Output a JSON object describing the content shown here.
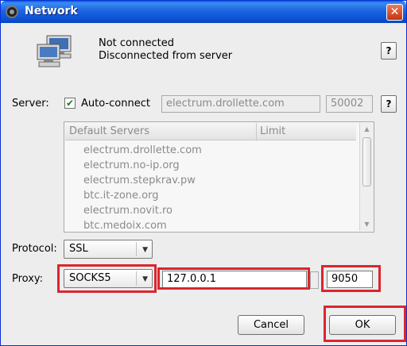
{
  "window": {
    "title": "Network",
    "close_glyph": "✕"
  },
  "status": {
    "line1": "Not connected",
    "line2": "Disconnected from server",
    "help_label": "?"
  },
  "server": {
    "label": "Server:",
    "auto_connect_label": "Auto-connect",
    "auto_connect_checked": true,
    "host": "electrum.drollette.com",
    "port": "50002",
    "help_label": "?"
  },
  "servers_list": {
    "columns": [
      "Default Servers",
      "Limit"
    ],
    "rows": [
      "electrum.drollette.com",
      "electrum.no-ip.org",
      "electrum.stepkrav.pw",
      "btc.it-zone.org",
      "electrum.novit.ro",
      "btc.medoix.com"
    ]
  },
  "protocol": {
    "label": "Protocol:",
    "value": "SSL"
  },
  "proxy": {
    "label": "Proxy:",
    "type": "SOCKS5",
    "host": "127.0.0.1",
    "port": "9050"
  },
  "buttons": {
    "cancel": "Cancel",
    "ok": "OK"
  },
  "colors": {
    "highlight": "#d9262f",
    "titlebar": "#1c64e3"
  },
  "icons": {
    "title": "electrum-logo-icon",
    "status": "network-computers-icon",
    "check": "checkmark-icon",
    "dropdown": "chevron-down-icon"
  }
}
